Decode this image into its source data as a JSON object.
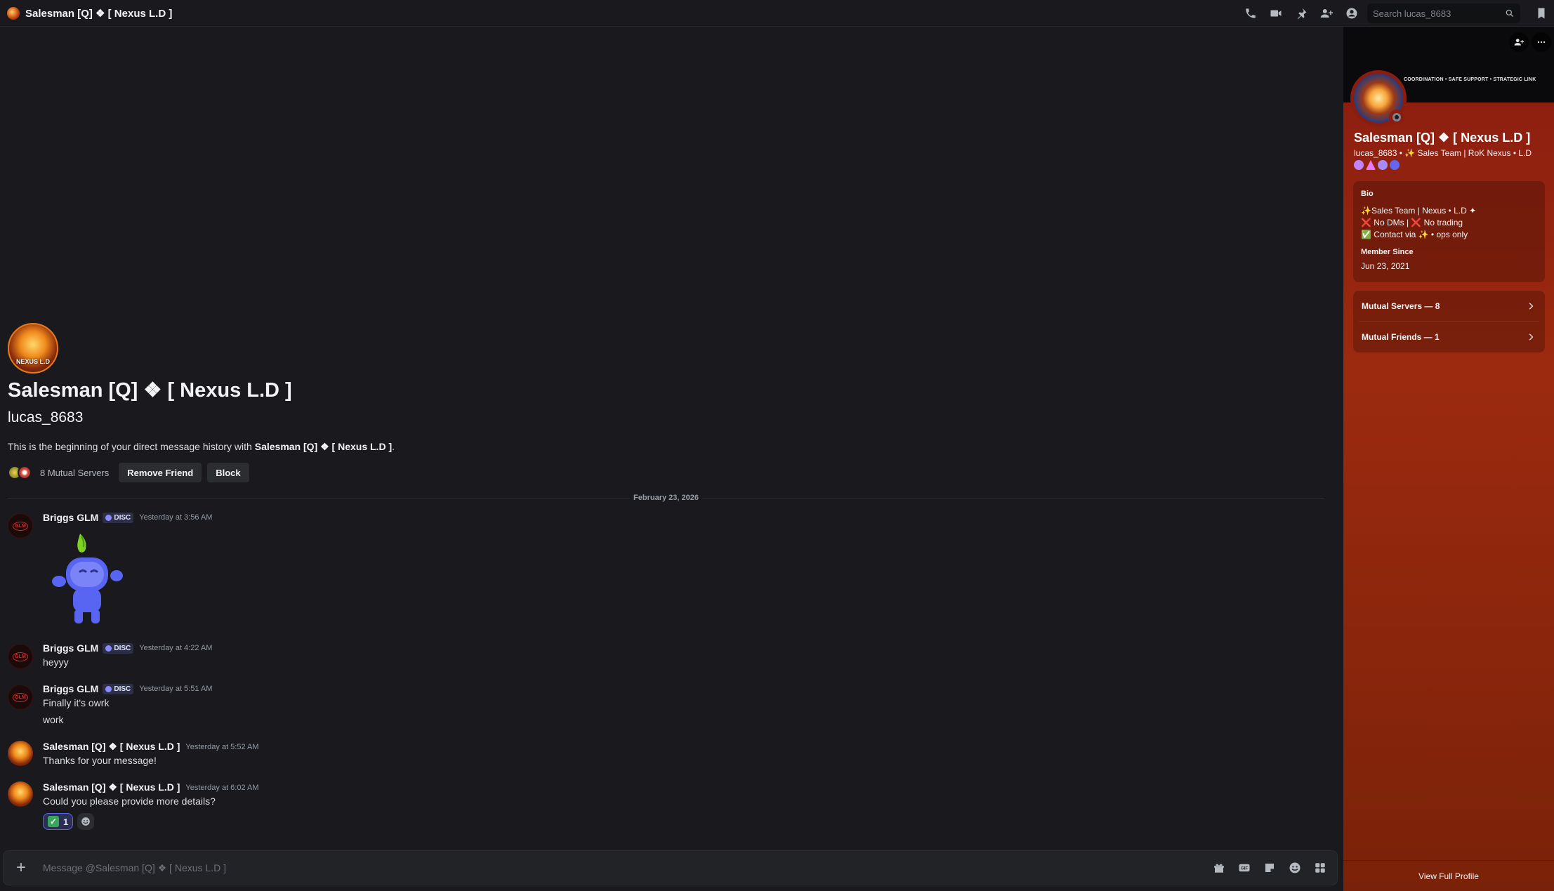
{
  "header": {
    "title": "Salesman [Q] ❖ [ Nexus L.D ]",
    "search_placeholder": "Search lucas_8683",
    "tool_icons": [
      "phone-icon",
      "video-icon",
      "pin-icon",
      "add-friend-icon",
      "profile-toggle-icon",
      "inbox-icon"
    ]
  },
  "intro": {
    "avatar_brand": "NEXUS L.D",
    "name": "Salesman [Q] ❖ [ Nexus L.D ]",
    "username": "lucas_8683",
    "desc_prefix": "This is the beginning of your direct message history with ",
    "desc_name": "Salesman [Q] ❖ [ Nexus L.D ]",
    "desc_suffix": ".",
    "mutual_servers": "8 Mutual Servers",
    "remove_friend": "Remove Friend",
    "block": "Block"
  },
  "date_divider": "February 23, 2026",
  "messages": [
    {
      "author": "Briggs GLM",
      "tag": "DISC",
      "time": "Yesterday at 3:56 AM",
      "avatar_text": "GLM"
    },
    {
      "author": "Briggs GLM",
      "tag": "DISC",
      "time": "Yesterday at 4:22 AM",
      "avatar_text": "GLM",
      "lines": [
        "heyyy"
      ]
    },
    {
      "author": "Briggs GLM",
      "tag": "DISC",
      "time": "Yesterday at 5:51 AM",
      "avatar_text": "GLM",
      "lines": [
        "Finally it's owrk",
        "work"
      ]
    },
    {
      "author": "Salesman [Q] ❖ [ Nexus L.D ]",
      "time": "Yesterday at 5:52 AM",
      "lines": [
        "Thanks for your message!"
      ]
    },
    {
      "author": "Salesman [Q] ❖ [ Nexus L.D ]",
      "time": "Yesterday at 6:02 AM",
      "lines": [
        "Could you please provide more details?"
      ]
    }
  ],
  "reaction": {
    "emoji": "✓",
    "count": "1"
  },
  "composer": {
    "placeholder": "Message @Salesman [Q] ❖ [ Nexus L.D ]",
    "icons": [
      "gift-icon",
      "gif-icon",
      "sticker-icon",
      "emoji-icon",
      "apps-icon"
    ]
  },
  "profile": {
    "banner_caption": "COORDINATION • SAFE SUPPORT • STRATEGIC LINK",
    "name": "Salesman [Q] ❖ [ Nexus L.D ]",
    "meta": "lucas_8683 • ✨ Sales Team | RoK Nexus • L.D",
    "bio_label": "Bio",
    "bio_lines": [
      "✨Sales Team | Nexus • L.D ✦",
      "❌ No DMs | ❌ No trading",
      "✅ Contact via ✨ • ops  only"
    ],
    "member_since_label": "Member Since",
    "member_since": "Jun 23, 2021",
    "mutual_servers": "Mutual Servers — 8",
    "mutual_friends": "Mutual Friends — 1",
    "view_full": "View Full Profile",
    "colors": {
      "panel_top": "#8a1c10",
      "panel_bottom": "#7a2209"
    }
  }
}
